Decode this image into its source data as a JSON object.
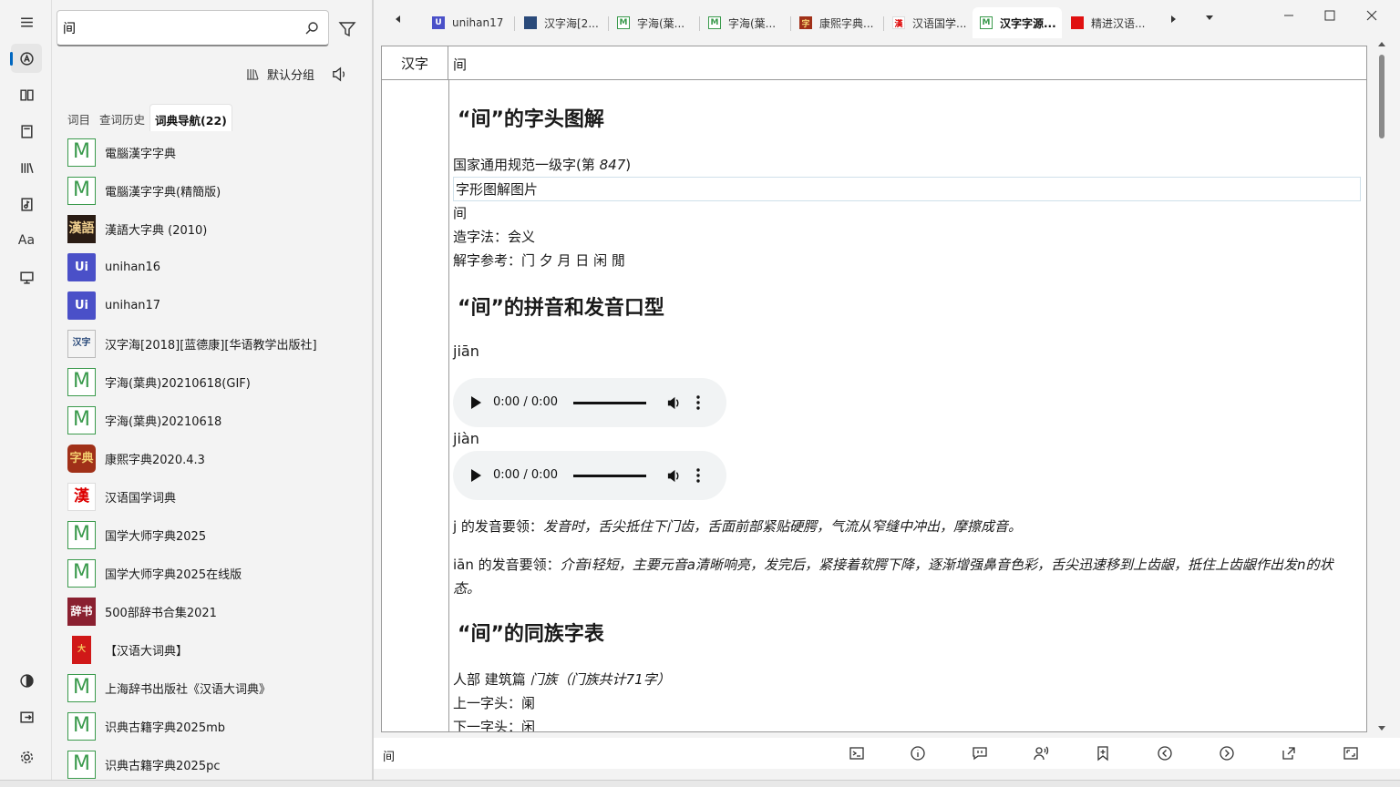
{
  "search": {
    "value": "间"
  },
  "group": {
    "label": "默认分组"
  },
  "left_tabs": [
    {
      "label": "词目"
    },
    {
      "label": "查词历史"
    },
    {
      "label": "词典导航(22)"
    }
  ],
  "dicts": [
    {
      "icon": "M",
      "name": "電腦漢字字典"
    },
    {
      "icon": "M",
      "name": "電腦漢字字典(精簡版)"
    },
    {
      "icon": "漢語",
      "name": "漢語大字典 (2010)"
    },
    {
      "icon": "Ui",
      "name": "unihan16"
    },
    {
      "icon": "Ui",
      "name": "unihan17"
    },
    {
      "icon": "汉字",
      "name": "汉字海[2018][蓝德康][华语教学出版社]"
    },
    {
      "icon": "M",
      "name": "字海(葉典)20210618(GIF)"
    },
    {
      "icon": "M",
      "name": "字海(葉典)20210618"
    },
    {
      "icon": "字典",
      "name": "康熙字典2020.4.3"
    },
    {
      "icon": "漢",
      "name": "汉语国学词典"
    },
    {
      "icon": "M",
      "name": "国学大师字典2025"
    },
    {
      "icon": "M",
      "name": "国学大师字典2025在线版"
    },
    {
      "icon": "辞书",
      "name": "500部辞书合集2021"
    },
    {
      "icon": "大",
      "name": "【汉语大词典】"
    },
    {
      "icon": "M",
      "name": "上海辞书出版社《汉语大词典》"
    },
    {
      "icon": "M",
      "name": "识典古籍字典2025mb"
    },
    {
      "icon": "M",
      "name": "识典古籍字典2025pc"
    }
  ],
  "tabs": [
    {
      "label": "unihan17"
    },
    {
      "label": "汉字海[2..."
    },
    {
      "label": "字海(葉..."
    },
    {
      "label": "字海(葉..."
    },
    {
      "label": "康熙字典..."
    },
    {
      "label": "汉语国学..."
    },
    {
      "label": "汉字字源..."
    },
    {
      "label": "精进汉语..."
    }
  ],
  "content": {
    "header_label": "汉字",
    "header_value": "间",
    "s1_title": "“间”的字头图解",
    "s1_line1": "国家通用规范一级字(第 ",
    "s1_line1_num": "847",
    "s1_line1_end": ")",
    "s1_img_alt": "字形图解图片",
    "s1_char": "间",
    "s1_method": "造字法：会义",
    "s1_ref": "解字参考：门 夕 月 日 闲 閒",
    "s2_title": "“间”的拼音和发音口型",
    "py1": "jiān",
    "py2": "jiàn",
    "audio_time": "0:00 / 0:00",
    "j_label": "j 的发音要领：",
    "j_text": "发音时，舌尖抵住下门齿，舌面前部紧贴硬腭，气流从窄缝中冲出，摩擦成音。",
    "ian_label": "iān 的发音要领：",
    "ian_text": "介音i轻短，主要元音a清晰响亮，发完后，紧接着软腭下降，逐渐增强鼻音色彩，舌尖迅速移到上齿龈，抵住上齿龈作出发n的状态。",
    "s3_title": "“间”的同族字表",
    "family_pre": "人部 建筑篇 ",
    "family_it": "门族（门族共计71字）",
    "prev": "上一字头：阑",
    "next": "下一字头：闲"
  },
  "status": {
    "word": "间"
  }
}
